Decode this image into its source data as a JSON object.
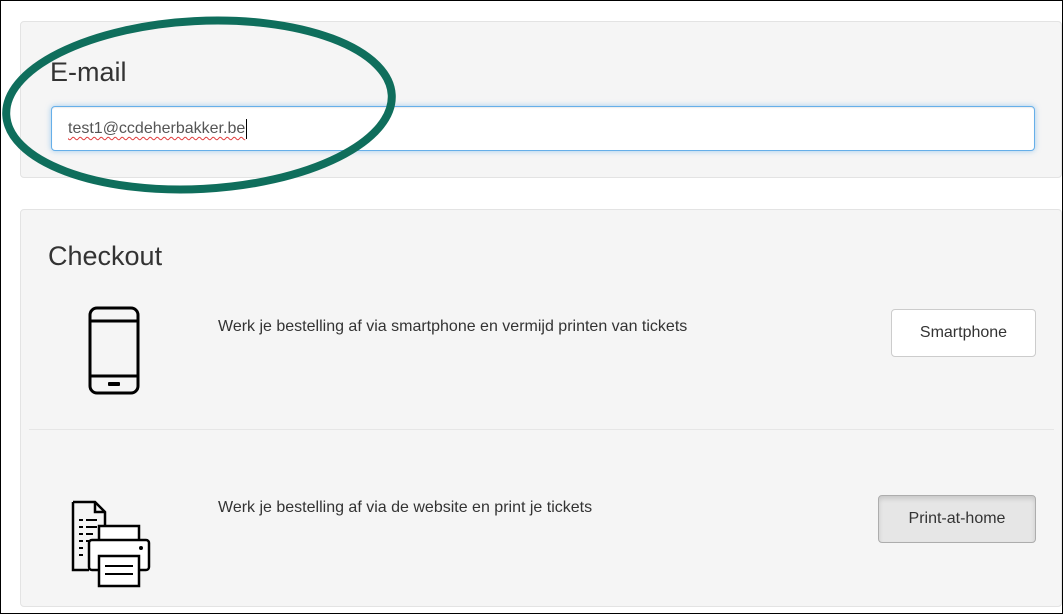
{
  "email": {
    "title": "E-mail",
    "value": "test1@ccdeherbakker.be"
  },
  "checkout": {
    "title": "Checkout",
    "options": [
      {
        "icon": "smartphone-icon",
        "description": "Werk je bestelling af via smartphone en vermijd printen van tickets",
        "button_label": "Smartphone"
      },
      {
        "icon": "printer-icon",
        "description": "Werk je bestelling af via de website en print je tickets",
        "button_label": "Print-at-home"
      }
    ]
  },
  "annotation": {
    "color": "#0f6e5c"
  }
}
